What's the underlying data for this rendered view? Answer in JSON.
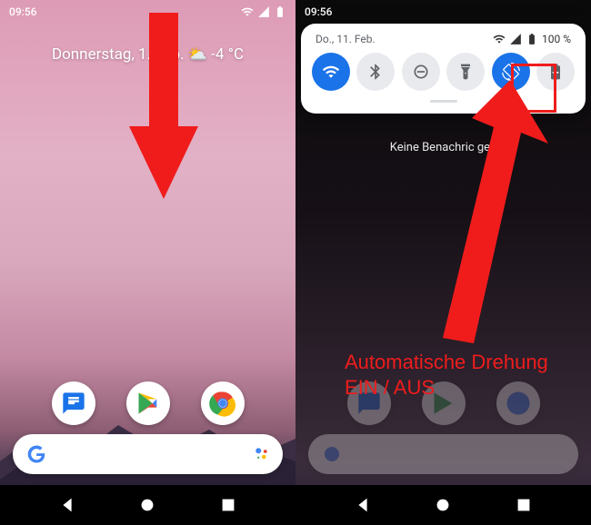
{
  "left": {
    "time": "09:56",
    "date_weather": "Donnerstag, 1.   Feb. ⛅ -4 °C",
    "dock": {
      "messages": "messages-app",
      "play": "play-store-app",
      "chrome": "chrome-app"
    },
    "nav": {
      "back": "back",
      "home": "home",
      "recent": "recent"
    }
  },
  "right": {
    "time": "09:56",
    "shade_date": "Do., 11. Feb.",
    "battery_pct": "100 %",
    "qs": {
      "wifi": "wifi",
      "bluetooth": "bluetooth",
      "dnd": "do-not-disturb",
      "flashlight": "flashlight",
      "rotate": "auto-rotate",
      "battery_saver": "battery-saver"
    },
    "no_notifications": "Keine Benachric            gen",
    "nav": {
      "back": "back",
      "home": "home",
      "recent": "recent"
    }
  },
  "annotation": {
    "text_line1": "Automatische Drehung",
    "text_line2": "EIN / AUS"
  },
  "colors": {
    "accent_blue": "#1a73e8",
    "annotation_red": "#f01c1c"
  }
}
